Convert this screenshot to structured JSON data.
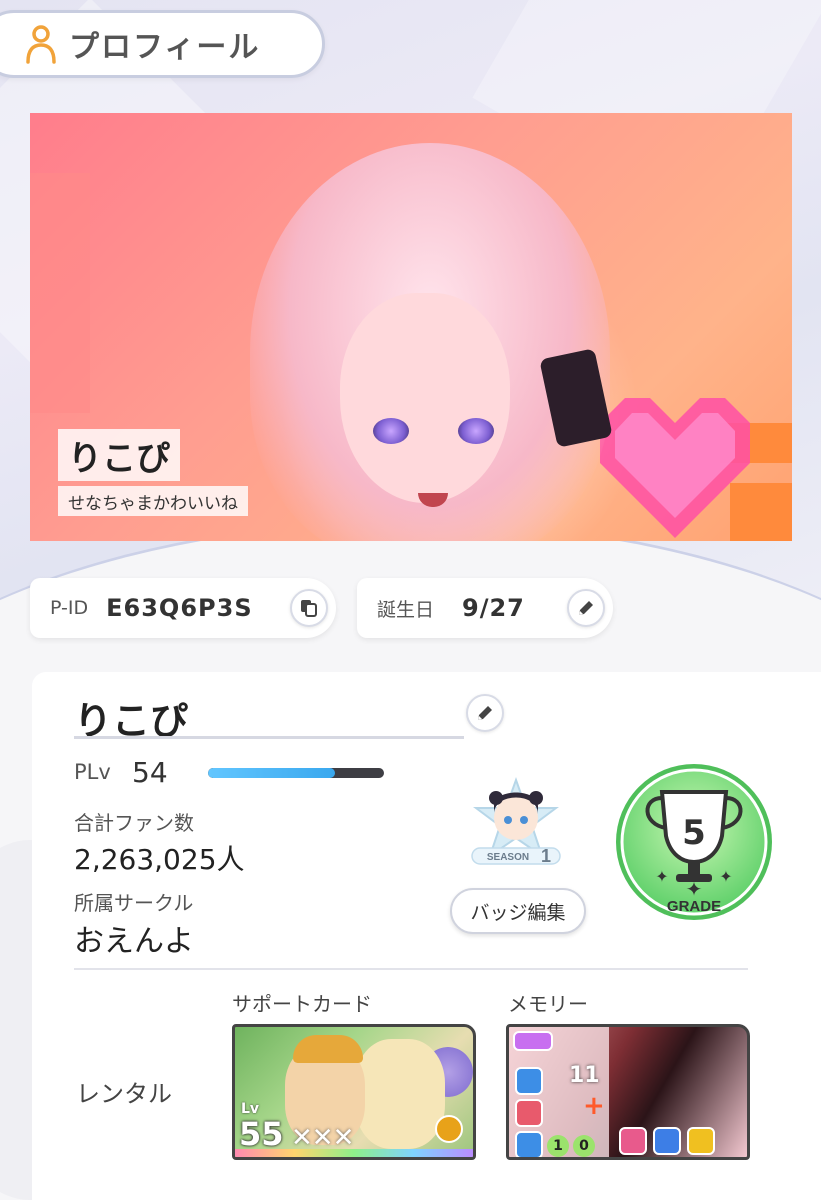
{
  "header": {
    "title": "プロフィール",
    "icon": "person-icon"
  },
  "banner": {
    "name": "りこぴ",
    "message": "せなちゃまかわいいね"
  },
  "info": {
    "pid_label": "P-ID",
    "pid_value": "E63Q6P3S",
    "birthday_label": "誕生日",
    "birthday_value": "9/27"
  },
  "profile": {
    "name": "りこぴ",
    "plv_label": "PLv",
    "plv_value": "54",
    "plv_progress": 0.72,
    "fans_label": "合計ファン数",
    "fans_value": "2,263,025人",
    "circle_label": "所属サークル",
    "circle_value": "おえんよ",
    "badge_season": "SEASON",
    "badge_season_num": "1",
    "badge_edit_label": "バッジ編集",
    "grade_number": "5",
    "grade_label": "GRADE"
  },
  "rental": {
    "label": "レンタル",
    "support_label": "サポートカード",
    "memory_label": "メモリー",
    "support_card": {
      "lv_label": "Lv",
      "lv_value": "55",
      "marks": "✕✕✕"
    },
    "memory_card": {
      "count": "11",
      "plus": "+",
      "stat1": "1",
      "stat2": "0"
    }
  },
  "colors": {
    "accent_blue": "#3aa8ee",
    "grade_green": "#7be07a",
    "icon_orange": "#f1a33a"
  }
}
